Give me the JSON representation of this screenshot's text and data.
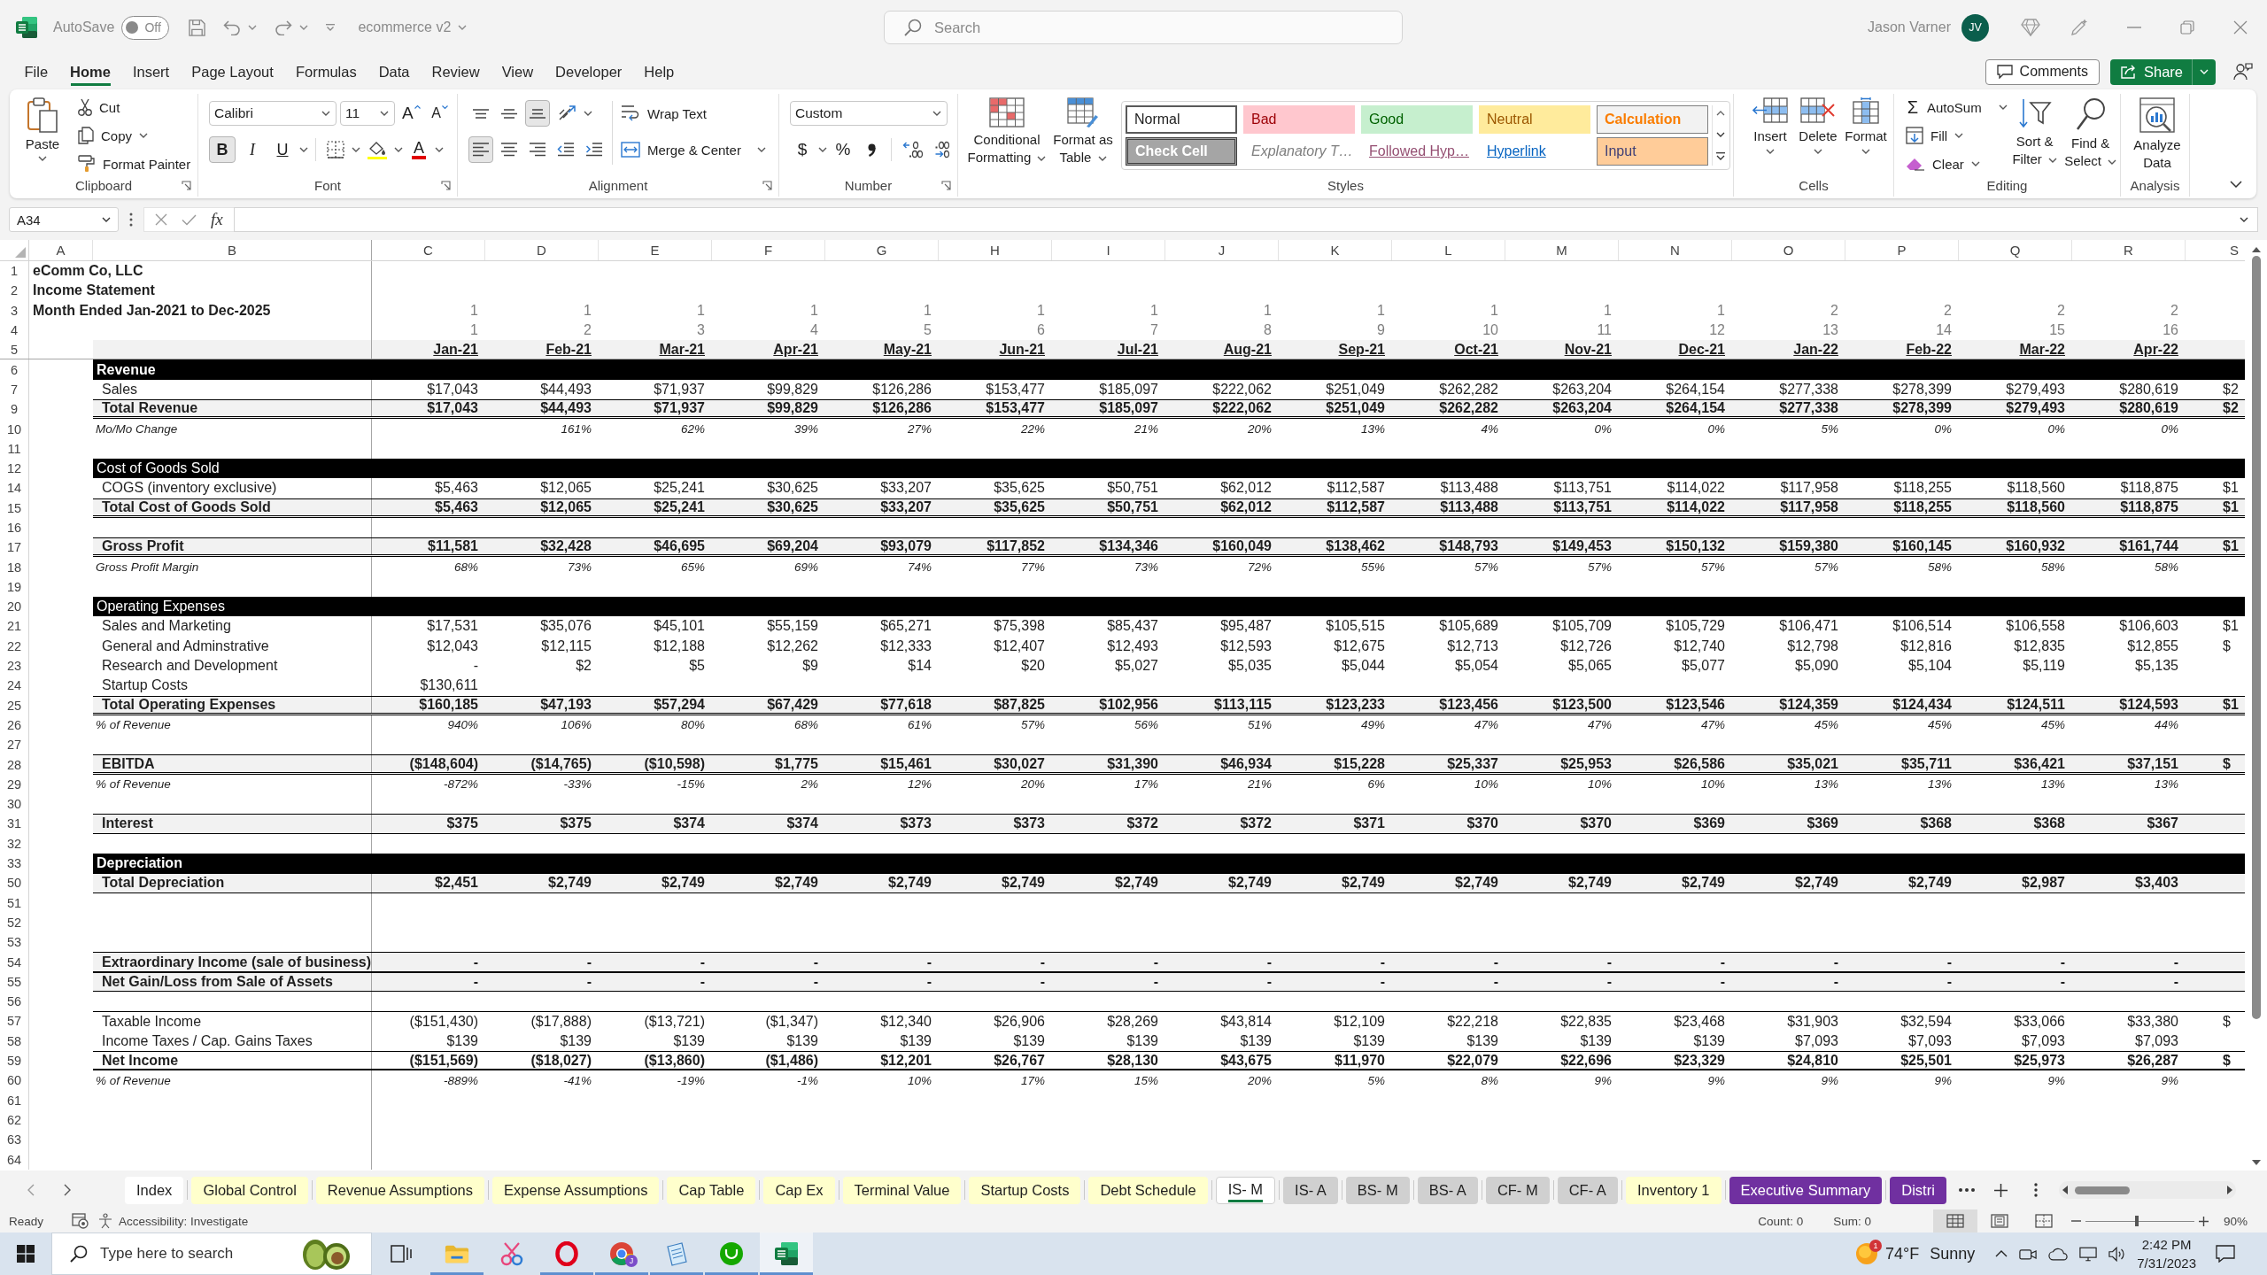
{
  "title_bar": {
    "autosave": {
      "label": "AutoSave",
      "state_text": "Off",
      "on": false
    },
    "file_name": "ecommerce v2",
    "search": {
      "placeholder": "Search"
    },
    "user": {
      "name": "Jason Varner",
      "initials": "JV"
    }
  },
  "menu": {
    "tabs": [
      {
        "label": "File",
        "selected": false
      },
      {
        "label": "Home",
        "selected": true
      },
      {
        "label": "Insert",
        "selected": false
      },
      {
        "label": "Page Layout",
        "selected": false
      },
      {
        "label": "Formulas",
        "selected": false
      },
      {
        "label": "Data",
        "selected": false
      },
      {
        "label": "Review",
        "selected": false
      },
      {
        "label": "View",
        "selected": false
      },
      {
        "label": "Developer",
        "selected": false
      },
      {
        "label": "Help",
        "selected": false
      }
    ],
    "comments": "Comments",
    "share": "Share"
  },
  "ribbon": {
    "clipboard": {
      "label": "Clipboard",
      "paste": "Paste",
      "cut": "Cut",
      "copy": "Copy",
      "format_painter": "Format Painter"
    },
    "font": {
      "label": "Font",
      "font_name": "Calibri",
      "font_size": "11",
      "grow_glyph": "A",
      "shrink_glyph": "A",
      "format_buttons": [
        {
          "kind": "bold",
          "glyph": "B",
          "selected": true
        },
        {
          "kind": "italic",
          "glyph": "I",
          "selected": false
        },
        {
          "kind": "underline",
          "glyph": "U",
          "selected": false
        }
      ],
      "font_color_glyph": "A"
    },
    "alignment": {
      "label": "Alignment",
      "vertical": [
        {
          "kind": "top",
          "selected": false
        },
        {
          "kind": "middle",
          "selected": false
        },
        {
          "kind": "bottom",
          "selected": true
        }
      ],
      "horizontal": [
        {
          "kind": "left",
          "selected": true
        },
        {
          "kind": "center",
          "selected": false
        },
        {
          "kind": "right",
          "selected": false
        }
      ],
      "wrap_text": "Wrap Text",
      "merge_center": "Merge & Center"
    },
    "number": {
      "label": "Number",
      "format": "Custom",
      "currency_glyph": "$",
      "percent_glyph": "%"
    },
    "styles": {
      "label": "Styles",
      "conditional_formatting": "Conditional Formatting",
      "format_as_table": "Format as Table",
      "gallery": [
        {
          "label": "Normal",
          "kind": "normal",
          "selected": true
        },
        {
          "label": "Bad",
          "kind": "bad",
          "selected": false
        },
        {
          "label": "Good",
          "kind": "good",
          "selected": false
        },
        {
          "label": "Neutral",
          "kind": "neutral",
          "selected": false
        },
        {
          "label": "Calculation",
          "kind": "calculation",
          "selected": false
        },
        {
          "label": "Check Cell",
          "kind": "check",
          "selected": false
        },
        {
          "label": "Explanatory T…",
          "kind": "explanatory",
          "selected": false
        },
        {
          "label": "Followed Hyp…",
          "kind": "followed",
          "selected": false
        },
        {
          "label": "Hyperlink",
          "kind": "hyperlink",
          "selected": false
        },
        {
          "label": "Input",
          "kind": "input",
          "selected": false
        }
      ]
    },
    "cells": {
      "label": "Cells",
      "buttons": [
        {
          "kind": "insert",
          "label": "Insert"
        },
        {
          "kind": "delete",
          "label": "Delete"
        },
        {
          "kind": "format",
          "label": "Format"
        }
      ]
    },
    "editing": {
      "label": "Editing",
      "autosum_glyph": "Σ",
      "autosum": "AutoSum",
      "fill": "Fill",
      "clear": "Clear",
      "sort_filter": "Sort & Filter",
      "find_select": "Find & Select"
    },
    "analysis": {
      "label": "Analysis",
      "analyze_data": "Analyze Data"
    }
  },
  "formula_bar": {
    "name_box": "A34",
    "fx_glyph": "fx"
  },
  "sheet": {
    "columns": [
      "A",
      "B",
      "C",
      "D",
      "E",
      "F",
      "G",
      "H",
      "I",
      "J",
      "K",
      "L",
      "M",
      "N",
      "O",
      "P",
      "Q",
      "R",
      "S"
    ],
    "rows": [
      {
        "row": "1",
        "kind": "title",
        "label": "eComm Co, LLC"
      },
      {
        "row": "2",
        "kind": "title",
        "label": "Income Statement"
      },
      {
        "row": "3",
        "kind": "title",
        "label": "Month Ended Jan-2021 to Dec-2025",
        "values": [
          "1",
          "1",
          "1",
          "1",
          "1",
          "1",
          "1",
          "1",
          "1",
          "1",
          "1",
          "1",
          "2",
          "2",
          "2",
          "2"
        ]
      },
      {
        "row": "4",
        "kind": "counter",
        "values": [
          "1",
          "2",
          "3",
          "4",
          "5",
          "6",
          "7",
          "8",
          "9",
          "10",
          "11",
          "12",
          "13",
          "14",
          "15",
          "16"
        ]
      },
      {
        "row": "5",
        "kind": "months",
        "values": [
          "Jan-21",
          "Feb-21",
          "Mar-21",
          "Apr-21",
          "May-21",
          "Jun-21",
          "Jul-21",
          "Aug-21",
          "Sep-21",
          "Oct-21",
          "Nov-21",
          "Dec-21",
          "Jan-22",
          "Feb-22",
          "Mar-22",
          "Apr-22"
        ]
      },
      {
        "row": "6",
        "kind": "heading",
        "label": "Revenue"
      },
      {
        "row": "7",
        "kind": "item",
        "label": "Sales",
        "values": [
          "$17,043",
          "$44,493",
          "$71,937",
          "$99,829",
          "$126,286",
          "$153,477",
          "$185,097",
          "$222,062",
          "$251,049",
          "$262,282",
          "$263,204",
          "$264,154",
          "$277,338",
          "$278,399",
          "$279,493",
          "$280,619",
          "$2"
        ]
      },
      {
        "row": "9",
        "kind": "total",
        "label": "Total Revenue",
        "values": [
          "$17,043",
          "$44,493",
          "$71,937",
          "$99,829",
          "$126,286",
          "$153,477",
          "$185,097",
          "$222,062",
          "$251,049",
          "$262,282",
          "$263,204",
          "$264,154",
          "$277,338",
          "$278,399",
          "$279,493",
          "$280,619",
          "$2"
        ]
      },
      {
        "row": "10",
        "kind": "change",
        "label": "Mo/Mo Change",
        "values": [
          "161%",
          "62%",
          "39%",
          "27%",
          "22%",
          "21%",
          "20%",
          "13%",
          "4%",
          "0%",
          "0%",
          "5%",
          "0%",
          "0%",
          "0%"
        ]
      },
      {
        "row": "11",
        "kind": "blank"
      },
      {
        "row": "12",
        "kind": "section",
        "label": "Cost of Goods Sold"
      },
      {
        "row": "14",
        "kind": "item",
        "label": "COGS (inventory exclusive)",
        "values": [
          "$5,463",
          "$12,065",
          "$25,241",
          "$30,625",
          "$33,207",
          "$35,625",
          "$50,751",
          "$62,012",
          "$112,587",
          "$113,488",
          "$113,751",
          "$114,022",
          "$117,958",
          "$118,255",
          "$118,560",
          "$118,875",
          "$1"
        ]
      },
      {
        "row": "15",
        "kind": "total",
        "label": "Total Cost of Goods Sold",
        "values": [
          "$5,463",
          "$12,065",
          "$25,241",
          "$30,625",
          "$33,207",
          "$35,625",
          "$50,751",
          "$62,012",
          "$112,587",
          "$113,488",
          "$113,751",
          "$114,022",
          "$117,958",
          "$118,255",
          "$118,560",
          "$118,875",
          "$1"
        ]
      },
      {
        "row": "16",
        "kind": "blank"
      },
      {
        "row": "17",
        "kind": "total",
        "label": "Gross Profit",
        "values": [
          "$11,581",
          "$32,428",
          "$46,695",
          "$69,204",
          "$93,079",
          "$117,852",
          "$134,346",
          "$160,049",
          "$138,462",
          "$148,793",
          "$149,453",
          "$150,132",
          "$159,380",
          "$160,145",
          "$160,932",
          "$161,744",
          "$1"
        ]
      },
      {
        "row": "18",
        "kind": "ratio",
        "label": "Gross Profit Margin",
        "values": [
          "68%",
          "73%",
          "65%",
          "69%",
          "74%",
          "77%",
          "73%",
          "72%",
          "55%",
          "57%",
          "57%",
          "57%",
          "57%",
          "58%",
          "58%",
          "58%"
        ]
      },
      {
        "row": "19",
        "kind": "blank"
      },
      {
        "row": "20",
        "kind": "section",
        "label": "Operating Expenses"
      },
      {
        "row": "21",
        "kind": "item",
        "label": "Sales and Marketing",
        "values": [
          "$17,531",
          "$35,076",
          "$45,101",
          "$55,159",
          "$65,271",
          "$75,398",
          "$85,437",
          "$95,487",
          "$105,515",
          "$105,689",
          "$105,709",
          "$105,729",
          "$106,471",
          "$106,514",
          "$106,558",
          "$106,603",
          "$1"
        ]
      },
      {
        "row": "22",
        "kind": "item",
        "label": "General and Adminstrative",
        "values": [
          "$12,043",
          "$12,115",
          "$12,188",
          "$12,262",
          "$12,333",
          "$12,407",
          "$12,493",
          "$12,593",
          "$12,675",
          "$12,713",
          "$12,726",
          "$12,740",
          "$12,798",
          "$12,816",
          "$12,835",
          "$12,855",
          "$"
        ]
      },
      {
        "row": "23",
        "kind": "item",
        "label": "Research and Development",
        "values": [
          "-",
          "$2",
          "$5",
          "$9",
          "$14",
          "$20",
          "$5,027",
          "$5,035",
          "$5,044",
          "$5,054",
          "$5,065",
          "$5,077",
          "$5,090",
          "$5,104",
          "$5,119",
          "$5,135"
        ]
      },
      {
        "row": "24",
        "kind": "item",
        "label": "Startup Costs",
        "values": [
          "$130,611"
        ]
      },
      {
        "row": "25",
        "kind": "total",
        "label": "Total Operating Expenses",
        "values": [
          "$160,185",
          "$47,193",
          "$57,294",
          "$67,429",
          "$77,618",
          "$87,825",
          "$102,956",
          "$113,115",
          "$123,233",
          "$123,456",
          "$123,500",
          "$123,546",
          "$124,359",
          "$124,434",
          "$124,511",
          "$124,593",
          "$1"
        ]
      },
      {
        "row": "26",
        "kind": "ratio",
        "label": "% of Revenue",
        "values": [
          "940%",
          "106%",
          "80%",
          "68%",
          "61%",
          "57%",
          "56%",
          "51%",
          "49%",
          "47%",
          "47%",
          "47%",
          "45%",
          "45%",
          "45%",
          "44%"
        ]
      },
      {
        "row": "27",
        "kind": "blank"
      },
      {
        "row": "28",
        "kind": "total",
        "label": "EBITDA",
        "values": [
          "($148,604)",
          "($14,765)",
          "($10,598)",
          "$1,775",
          "$15,461",
          "$30,027",
          "$31,390",
          "$46,934",
          "$15,228",
          "$25,337",
          "$25,953",
          "$26,586",
          "$35,021",
          "$35,711",
          "$36,421",
          "$37,151",
          "$"
        ]
      },
      {
        "row": "29",
        "kind": "ratio",
        "label": "% of Revenue",
        "values": [
          "-872%",
          "-33%",
          "-15%",
          "2%",
          "12%",
          "20%",
          "17%",
          "21%",
          "6%",
          "10%",
          "10%",
          "10%",
          "13%",
          "13%",
          "13%",
          "13%"
        ]
      },
      {
        "row": "30",
        "kind": "blank"
      },
      {
        "row": "31",
        "kind": "subtotal",
        "label": "Interest",
        "values": [
          "$375",
          "$375",
          "$374",
          "$374",
          "$373",
          "$373",
          "$372",
          "$372",
          "$371",
          "$370",
          "$370",
          "$369",
          "$369",
          "$368",
          "$368",
          "$367"
        ]
      },
      {
        "row": "32",
        "kind": "blank"
      },
      {
        "row": "33",
        "kind": "heading",
        "label": "Depreciation"
      },
      {
        "row": "50",
        "kind": "subtotal",
        "label": "Total Depreciation",
        "values": [
          "$2,451",
          "$2,749",
          "$2,749",
          "$2,749",
          "$2,749",
          "$2,749",
          "$2,749",
          "$2,749",
          "$2,749",
          "$2,749",
          "$2,749",
          "$2,749",
          "$2,749",
          "$2,749",
          "$2,987",
          "$3,403"
        ]
      },
      {
        "row": "51",
        "kind": "blank"
      },
      {
        "row": "52",
        "kind": "blank"
      },
      {
        "row": "53",
        "kind": "blank"
      },
      {
        "row": "54",
        "kind": "subtotal",
        "label": "Extraordinary Income (sale of business)",
        "values": [
          "-",
          "-",
          "-",
          "-",
          "-",
          "-",
          "-",
          "-",
          "-",
          "-",
          "-",
          "-",
          "-",
          "-",
          "-",
          "-"
        ]
      },
      {
        "row": "55",
        "kind": "subtotal",
        "label": "Net Gain/Loss from Sale of Assets",
        "values": [
          "-",
          "-",
          "-",
          "-",
          "-",
          "-",
          "-",
          "-",
          "-",
          "-",
          "-",
          "-",
          "-",
          "-",
          "-",
          "-"
        ]
      },
      {
        "row": "56",
        "kind": "blank"
      },
      {
        "row": "57",
        "kind": "ruled",
        "label": "Taxable Income",
        "values": [
          "($151,430)",
          "($17,888)",
          "($13,721)",
          "($1,347)",
          "$12,340",
          "$26,906",
          "$28,269",
          "$43,814",
          "$12,109",
          "$22,218",
          "$22,835",
          "$23,468",
          "$31,903",
          "$32,594",
          "$33,066",
          "$33,380",
          "$"
        ]
      },
      {
        "row": "58",
        "kind": "item",
        "label": "Income Taxes / Cap. Gains Taxes",
        "values": [
          "$139",
          "$139",
          "$139",
          "$139",
          "$139",
          "$139",
          "$139",
          "$139",
          "$139",
          "$139",
          "$139",
          "$139",
          "$7,093",
          "$7,093",
          "$7,093",
          "$7,093"
        ]
      },
      {
        "row": "59",
        "kind": "net",
        "label": "Net Income",
        "values": [
          "($151,569)",
          "($18,027)",
          "($13,860)",
          "($1,486)",
          "$12,201",
          "$26,767",
          "$28,130",
          "$43,675",
          "$11,970",
          "$22,079",
          "$22,696",
          "$23,329",
          "$24,810",
          "$25,501",
          "$25,973",
          "$26,287",
          "$"
        ]
      },
      {
        "row": "60",
        "kind": "ratio",
        "label": "% of Revenue",
        "values": [
          "-889%",
          "-41%",
          "-19%",
          "-1%",
          "10%",
          "17%",
          "15%",
          "20%",
          "5%",
          "8%",
          "9%",
          "9%",
          "9%",
          "9%",
          "9%",
          "9%"
        ]
      },
      {
        "row": "61",
        "kind": "blank"
      },
      {
        "row": "62",
        "kind": "blank"
      },
      {
        "row": "63",
        "kind": "blank"
      },
      {
        "row": "64",
        "kind": "blank"
      }
    ]
  },
  "sheet_tabs": [
    {
      "label": "Index",
      "color": "#ffffff",
      "selected": false
    },
    {
      "label": "Global Control",
      "color": "#ffffcc",
      "selected": false
    },
    {
      "label": "Revenue Assumptions",
      "color": "#ffffcc",
      "selected": false
    },
    {
      "label": "Expense Assumptions",
      "color": "#ffffcc",
      "selected": false
    },
    {
      "label": "Cap Table",
      "color": "#ffffcc",
      "selected": false
    },
    {
      "label": "Cap Ex",
      "color": "#ffffcc",
      "selected": false
    },
    {
      "label": "Terminal Value",
      "color": "#ffffcc",
      "selected": false
    },
    {
      "label": "Startup Costs",
      "color": "#ffffcc",
      "selected": false
    },
    {
      "label": "Debt Schedule",
      "color": "#ffffcc",
      "selected": false
    },
    {
      "label": "IS- M",
      "selected": true
    },
    {
      "label": "IS- A",
      "color": "#d0d0d0",
      "selected": false
    },
    {
      "label": "BS- M",
      "color": "#d0d0d0",
      "selected": false
    },
    {
      "label": "BS- A",
      "color": "#d0d0d0",
      "selected": false
    },
    {
      "label": "CF- M",
      "color": "#d0d0d0",
      "selected": false
    },
    {
      "label": "CF- A",
      "color": "#d0d0d0",
      "selected": false
    },
    {
      "label": "Inventory 1",
      "color": "#ffffcc",
      "selected": false
    },
    {
      "label": "Executive Summary",
      "color": "#7030a0",
      "selected": false
    },
    {
      "label": "Distri",
      "color": "#7030a0",
      "selected": false
    }
  ],
  "status_bar": {
    "mode": "Ready",
    "accessibility": "Accessibility: Investigate",
    "count": "Count: 0",
    "sum": "Sum: 0",
    "views": [
      {
        "kind": "normal",
        "selected": true
      },
      {
        "kind": "page_layout",
        "selected": false
      },
      {
        "kind": "page_break",
        "selected": false
      }
    ],
    "zoom_slider": {
      "level": 0.47
    },
    "zoom": "90%"
  },
  "taskbar": {
    "search": {
      "placeholder": "Type here to search"
    },
    "apps": [
      {
        "kind": "explorer",
        "running": true,
        "selected": false
      },
      {
        "kind": "snip",
        "running": false,
        "selected": false
      },
      {
        "kind": "opera",
        "running": true,
        "selected": false
      },
      {
        "kind": "chrome",
        "running": true,
        "selected": false,
        "badge": "J"
      },
      {
        "kind": "notepad",
        "running": true,
        "selected": false
      },
      {
        "kind": "upwork",
        "running": true,
        "selected": false
      },
      {
        "kind": "excel",
        "running": true,
        "selected": true
      }
    ],
    "weather": {
      "badge": "1",
      "temperature": "74°F",
      "condition": "Sunny"
    },
    "clock": {
      "time": "2:42 PM",
      "date": "7/31/2023"
    }
  }
}
